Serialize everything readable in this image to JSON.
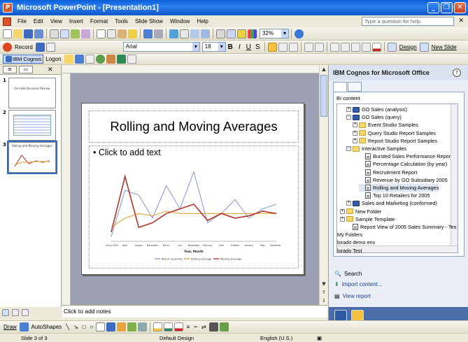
{
  "window": {
    "title": "Microsoft PowerPoint - [Presentation1]"
  },
  "menu": {
    "items": [
      "File",
      "Edit",
      "View",
      "Insert",
      "Format",
      "Tools",
      "Slide Show",
      "Window",
      "Help"
    ],
    "help_placeholder": "Type a question for help"
  },
  "toolbar": {
    "zoom": "32%",
    "record_label": "Record",
    "font_name": "Arial",
    "font_size": "18",
    "bold": "B",
    "italic": "I",
    "underline": "U",
    "shadow": "S",
    "design_label": "Design",
    "new_slide_label": "New Slide",
    "cognos_label": "IBM Cognos",
    "logon_label": "Logon"
  },
  "slides_pane": {
    "thumbnails": [
      {
        "number": "1",
        "title": "On-slide Business Review"
      },
      {
        "number": "2",
        "title": ""
      },
      {
        "number": "3",
        "title": "Rolling and Moving Averages"
      }
    ]
  },
  "slide": {
    "title": "Rolling and Moving Averages",
    "bullet": "• Click to add text"
  },
  "notes_placeholder": "Click to add notes",
  "task_pane": {
    "title": "IBM Cognos for Microsoft Office",
    "help": "?",
    "section_label": "BI content",
    "tree": [
      {
        "label": "GO Sales (analysis)",
        "icon": "package",
        "level": 1,
        "expander": "+"
      },
      {
        "label": "GO Sales (query)",
        "icon": "package",
        "level": 1,
        "expander": "−"
      },
      {
        "label": "Event Studio Samples",
        "icon": "folder",
        "level": 2,
        "expander": "+"
      },
      {
        "label": "Query Studio Report Samples",
        "icon": "folder",
        "level": 2,
        "expander": "+"
      },
      {
        "label": "Report Studio Report Samples",
        "icon": "folder",
        "level": 2,
        "expander": "+"
      },
      {
        "label": "Interactive Samples",
        "icon": "folder",
        "level": 1,
        "expander": "−"
      },
      {
        "label": "Bursted Sales Performance Repor",
        "icon": "report",
        "level": 3,
        "expander": ""
      },
      {
        "label": "Percentage Calculation (by year)",
        "icon": "report",
        "level": 3,
        "expander": ""
      },
      {
        "label": "Recruitment Report",
        "icon": "report",
        "level": 3,
        "expander": ""
      },
      {
        "label": "Revenue by GO Subsidiary 2005",
        "icon": "report",
        "level": 3,
        "expander": ""
      },
      {
        "label": "Rolling and Moving Averages",
        "icon": "report",
        "level": 3,
        "expander": "",
        "selected": true
      },
      {
        "label": "Top 10 Retailers for 2005",
        "icon": "report",
        "level": 3,
        "expander": ""
      },
      {
        "label": "Sales and Marketing (conformed)",
        "icon": "package",
        "level": 1,
        "expander": "+"
      },
      {
        "label": "New Folder",
        "icon": "folder",
        "level": 0,
        "expander": "+"
      },
      {
        "label": "Sample Template",
        "icon": "folder",
        "level": 0,
        "expander": "+"
      },
      {
        "label": "Report View of 2005 Sales Summary - Tes",
        "icon": "report",
        "level": 1,
        "expander": ""
      },
      {
        "label": "My Folders",
        "icon": "none",
        "level": -1,
        "expander": ""
      },
      {
        "label": "lorado demo env",
        "icon": "none",
        "level": -1,
        "expander": ""
      },
      {
        "label": "lorado Test",
        "icon": "none",
        "level": -1,
        "expander": ""
      }
    ],
    "links": {
      "search": "Search",
      "import": "Import content...",
      "view_report": "View report"
    }
  },
  "drawbar": {
    "draw_label": "Draw",
    "autoshapes_label": "AutoShapes"
  },
  "status": {
    "slide": "Slide 3 of 3",
    "design": "Default Design",
    "language": "English (U.S.)"
  },
  "chart_data": {
    "type": "line",
    "xlabel": "Year, Month",
    "categories": [
      "Spring 2004",
      "April",
      "August",
      "December",
      "March",
      "July",
      "November",
      "February",
      "June",
      "October",
      "January",
      "May",
      "September"
    ],
    "series": [
      {
        "name": "Return quantity",
        "color": "#8a9fd8",
        "values": [
          2,
          22,
          20,
          10,
          24,
          14,
          30,
          8,
          12,
          18,
          10,
          14,
          16
        ]
      },
      {
        "name": "Rolling average",
        "color": "#e0a23a",
        "values": [
          6,
          10,
          12,
          11,
          13,
          12,
          12,
          12,
          12,
          12,
          12,
          12,
          12
        ]
      },
      {
        "name": "Moving average",
        "color": "#b83228",
        "values": [
          4,
          28,
          6,
          8,
          12,
          14,
          16,
          9,
          12,
          10,
          11,
          13,
          12
        ]
      }
    ],
    "ylim": [
      0,
      32
    ]
  }
}
